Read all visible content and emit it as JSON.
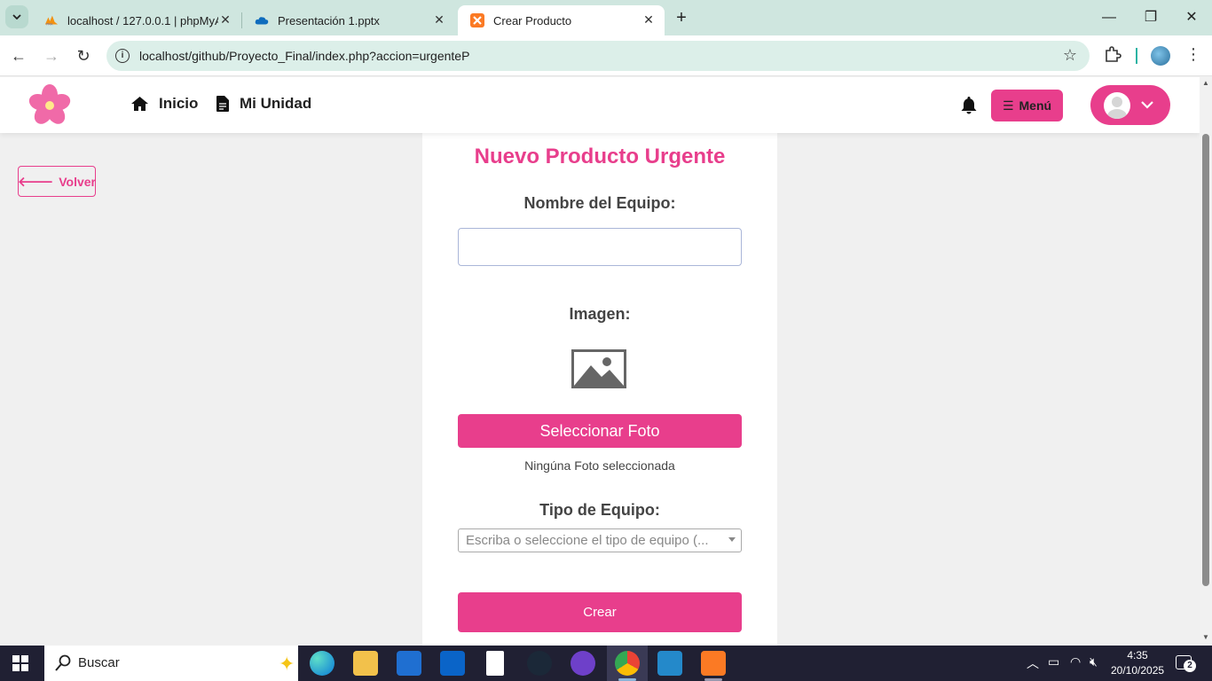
{
  "browser": {
    "tabs": [
      {
        "title": "localhost / 127.0.0.1 | phpMyAd",
        "favicon": "phpmyadmin-icon"
      },
      {
        "title": "Presentación 1.pptx",
        "favicon": "onedrive-cloud-icon"
      },
      {
        "title": "Crear Producto",
        "favicon": "xampp-icon",
        "active": true
      }
    ],
    "url": "localhost/github/Proyecto_Final/index.php?accion=urgenteP"
  },
  "header": {
    "nav": [
      {
        "label": "Inicio",
        "icon": "home-icon"
      },
      {
        "label": "Mi Unidad",
        "icon": "document-icon"
      }
    ],
    "menu_label": "Menú"
  },
  "page": {
    "back_label": "Volver",
    "form_title": "Nuevo Producto Urgente",
    "name_label": "Nombre del Equipo:",
    "name_value": "",
    "image_label": "Imagen:",
    "select_photo_label": "Seleccionar Foto",
    "photo_status": "Ningúna Foto seleccionada",
    "type_label": "Tipo de Equipo:",
    "type_placeholder": "Escriba o seleccione el tipo de equipo (...",
    "create_label": "Crear"
  },
  "taskbar": {
    "search_label": "Buscar",
    "time": "4:35",
    "date": "20/10/2025",
    "notification_count": "2"
  },
  "colors": {
    "accent": "#e83e8c",
    "tabstrip": "#cfe6df",
    "taskbar": "#202033"
  }
}
